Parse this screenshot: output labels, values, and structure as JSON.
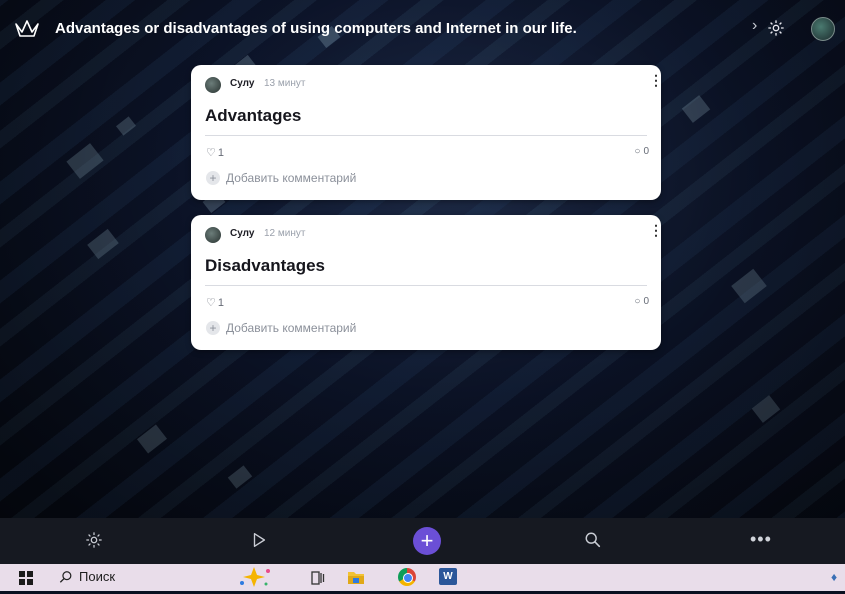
{
  "header": {
    "title": "Advantages or disadvantages of using computers and Internet in our life."
  },
  "posts": [
    {
      "author": "Сулу",
      "time": "13 минут",
      "title": "Advantages",
      "likes": "1",
      "comments": "0",
      "add_comment": "Добавить комментарий"
    },
    {
      "author": "Сулу",
      "time": "12 минут",
      "title": "Disadvantages",
      "likes": "1",
      "comments": "0",
      "add_comment": "Добавить комментарий"
    }
  ],
  "taskbar": {
    "search_label": "Поиск",
    "word_label": "W"
  },
  "colors": {
    "accent": "#6b4fd6",
    "card_bg": "#ffffff",
    "bottom_bar": "#161921",
    "taskbar": "#e9ddea"
  }
}
